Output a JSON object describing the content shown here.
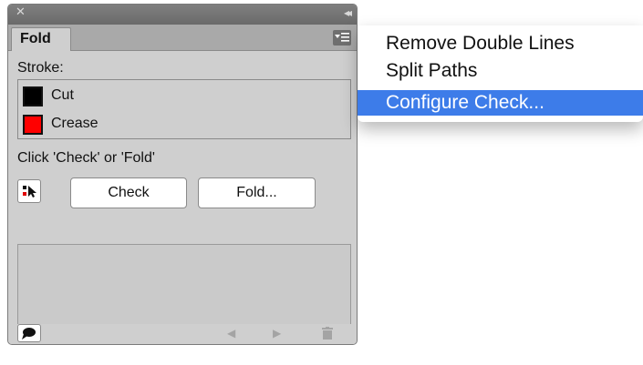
{
  "panel": {
    "tab_label": "Fold",
    "stroke_label": "Stroke:",
    "strokes": [
      {
        "label": "Cut",
        "color": "#000000"
      },
      {
        "label": "Crease",
        "color": "#ff0000"
      }
    ],
    "hint": "Click 'Check' or 'Fold'",
    "check_label": "Check",
    "fold_label": "Fold..."
  },
  "icons": {
    "close": "close-icon",
    "collapse": "collapse-icon",
    "menu": "panel-menu-icon",
    "select_tool": "select-tool-icon",
    "speech": "speech-bubble-icon",
    "prev": "previous-arrow-icon",
    "next": "next-arrow-icon",
    "trash": "trash-icon"
  },
  "menu": {
    "items": [
      {
        "label": "Remove Double Lines"
      },
      {
        "label": "Split Paths"
      },
      {
        "label": "Configure Check..."
      }
    ],
    "selected_index": 2,
    "highlight_color": "#3d7ce9"
  }
}
